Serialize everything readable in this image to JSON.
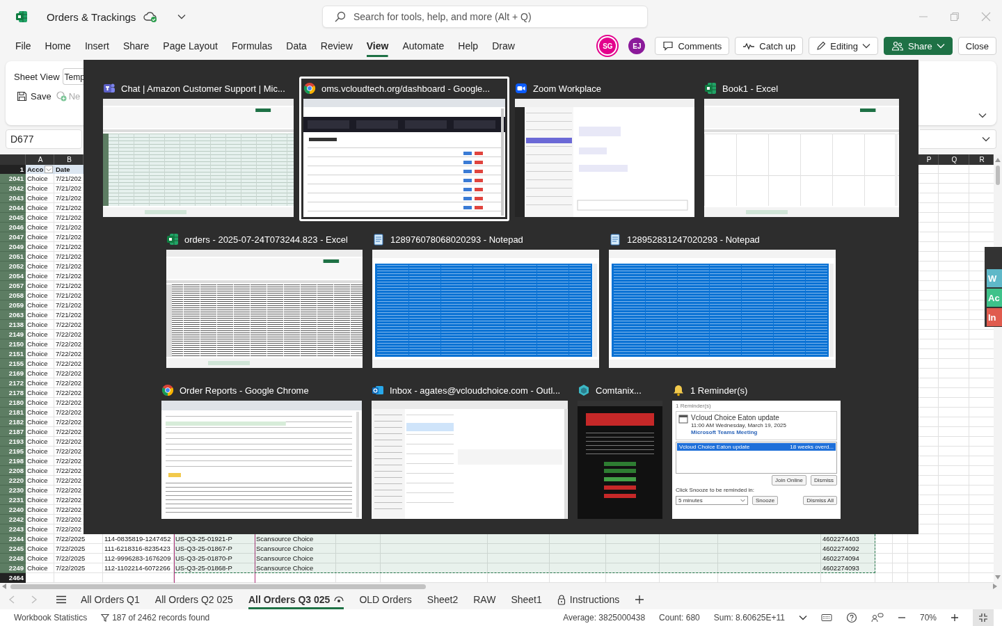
{
  "title_bar": {
    "document": "Orders & Trackings",
    "saved": true,
    "search_placeholder": "Search for tools, help, and more (Alt + Q)"
  },
  "menu": [
    {
      "label": "File",
      "selected": false
    },
    {
      "label": "Home",
      "selected": false
    },
    {
      "label": "Insert",
      "selected": false
    },
    {
      "label": "Share",
      "selected": false
    },
    {
      "label": "Page Layout",
      "selected": false
    },
    {
      "label": "Formulas",
      "selected": false
    },
    {
      "label": "Data",
      "selected": false
    },
    {
      "label": "Review",
      "selected": false
    },
    {
      "label": "View",
      "selected": true
    },
    {
      "label": "Automate",
      "selected": false
    },
    {
      "label": "Help",
      "selected": false
    },
    {
      "label": "Draw",
      "selected": false
    }
  ],
  "collaborators": [
    {
      "initials": "SG",
      "color": "#e3008c",
      "active": true
    },
    {
      "initials": "EJ",
      "color": "#8b1a9a",
      "active": false
    }
  ],
  "actions": [
    {
      "label": "Comments",
      "kind": "comments"
    },
    {
      "label": "Catch up",
      "kind": "catch-up"
    },
    {
      "label": "Editing",
      "kind": "editing"
    },
    {
      "label": "Share",
      "kind": "share"
    },
    {
      "label": "Close",
      "kind": "close"
    }
  ],
  "ribbon": {
    "sheet_view_label": "Sheet View",
    "sheet_view_value": "Temp",
    "save": "Save",
    "new": "Ne"
  },
  "name_box": "D677",
  "sheet": {
    "left_columns": [
      "A",
      "B"
    ],
    "right_columns": [
      "P",
      "Q",
      "R"
    ],
    "header_row": {
      "num": "1",
      "cells": [
        "Acco",
        "Date"
      ]
    },
    "rows": [
      {
        "num": "2041",
        "highlighted": true,
        "account": "Choice",
        "date": "7/21/202"
      },
      {
        "num": "2042",
        "highlighted": true,
        "account": "Choice",
        "date": "7/21/202"
      },
      {
        "num": "2043",
        "highlighted": true,
        "account": "Choice",
        "date": "7/21/202"
      },
      {
        "num": "2044",
        "highlighted": true,
        "account": "Choice",
        "date": "7/21/202"
      },
      {
        "num": "2045",
        "highlighted": true,
        "account": "Choice",
        "date": "7/21/202"
      },
      {
        "num": "2046",
        "highlighted": true,
        "account": "Choice",
        "date": "7/21/202"
      },
      {
        "num": "2047",
        "highlighted": true,
        "account": "Choice",
        "date": "7/21/202"
      },
      {
        "num": "2049",
        "highlighted": true,
        "account": "Choice",
        "date": "7/21/202"
      },
      {
        "num": "2051",
        "highlighted": true,
        "account": "Choice",
        "date": "7/21/202"
      },
      {
        "num": "2052",
        "highlighted": true,
        "account": "Choice",
        "date": "7/21/202"
      },
      {
        "num": "2054",
        "highlighted": true,
        "account": "Choice",
        "date": "7/21/202"
      },
      {
        "num": "2057",
        "highlighted": true,
        "account": "Choice",
        "date": "7/21/202"
      },
      {
        "num": "2058",
        "highlighted": true,
        "account": "Choice",
        "date": "7/21/202"
      },
      {
        "num": "2059",
        "highlighted": true,
        "account": "Choice",
        "date": "7/21/202"
      },
      {
        "num": "2063",
        "highlighted": true,
        "account": "Choice",
        "date": "7/21/202"
      },
      {
        "num": "2138",
        "highlighted": true,
        "account": "Choice",
        "date": "7/22/202"
      },
      {
        "num": "2149",
        "highlighted": true,
        "account": "Choice",
        "date": "7/22/202"
      },
      {
        "num": "2150",
        "highlighted": true,
        "account": "Choice",
        "date": "7/22/202"
      },
      {
        "num": "2151",
        "highlighted": true,
        "account": "Choice",
        "date": "7/22/202"
      },
      {
        "num": "2155",
        "highlighted": true,
        "account": "Choice",
        "date": "7/22/202"
      },
      {
        "num": "2169",
        "highlighted": true,
        "account": "Choice",
        "date": "7/22/202"
      },
      {
        "num": "2172",
        "highlighted": true,
        "account": "Choice",
        "date": "7/22/202"
      },
      {
        "num": "2178",
        "highlighted": true,
        "account": "Choice",
        "date": "7/22/202"
      },
      {
        "num": "2180",
        "highlighted": true,
        "account": "Choice",
        "date": "7/22/202"
      },
      {
        "num": "2181",
        "highlighted": true,
        "account": "Choice",
        "date": "7/22/202"
      },
      {
        "num": "2182",
        "highlighted": true,
        "account": "Choice",
        "date": "7/22/202"
      },
      {
        "num": "2187",
        "highlighted": true,
        "account": "Choice",
        "date": "7/22/202"
      },
      {
        "num": "2193",
        "highlighted": true,
        "account": "Choice",
        "date": "7/22/202"
      },
      {
        "num": "2195",
        "highlighted": true,
        "account": "Choice",
        "date": "7/22/202"
      },
      {
        "num": "2198",
        "highlighted": true,
        "account": "Choice",
        "date": "7/22/202"
      },
      {
        "num": "2208",
        "highlighted": true,
        "account": "Choice",
        "date": "7/22/202"
      },
      {
        "num": "2220",
        "highlighted": true,
        "account": "Choice",
        "date": "7/22/202"
      },
      {
        "num": "2230",
        "highlighted": true,
        "account": "Choice",
        "date": "7/22/202"
      },
      {
        "num": "2231",
        "highlighted": true,
        "account": "Choice",
        "date": "7/22/202"
      },
      {
        "num": "2240",
        "highlighted": true,
        "account": "Choice",
        "date": "7/22/202"
      },
      {
        "num": "2242",
        "highlighted": true,
        "account": "Choice",
        "date": "7/22/202"
      },
      {
        "num": "2243",
        "highlighted": true,
        "account": "Choice",
        "date": "7/22/202"
      },
      {
        "num": "2244",
        "highlighted": true,
        "account": "Choice",
        "date": "7/22/2025",
        "order": "114-0835819-1247452",
        "po": "US-Q3-25-01921-P",
        "vendor": "Scansource Choice",
        "tracking": "4602274403"
      },
      {
        "num": "2245",
        "highlighted": true,
        "account": "Choice",
        "date": "7/22/2025",
        "order": "111-6218316-8235423",
        "po": "US-Q3-25-01867-P",
        "vendor": "Scansource Choice",
        "tracking": "4602274092"
      },
      {
        "num": "2248",
        "highlighted": true,
        "account": "Choice",
        "date": "7/22/2025",
        "order": "112-9996283-1676209",
        "po": "US-Q3-25-01870-P",
        "vendor": "Scansource Choice",
        "tracking": "4602274094"
      },
      {
        "num": "2249",
        "highlighted": true,
        "account": "Choice",
        "date": "7/22/2025",
        "order": "112-1102214-6072266",
        "po": "US-Q3-25-01868-P",
        "vendor": "Scansource Choice",
        "tracking": "4602274093"
      },
      {
        "num": "2464",
        "highlighted": false
      }
    ]
  },
  "side_panel": {
    "buttons": [
      {
        "label": "W",
        "color": "#5fb8c8"
      },
      {
        "label": "Ac",
        "color": "#3ec28a"
      },
      {
        "label": "In",
        "color": "#e05b4e"
      }
    ]
  },
  "task_switcher": {
    "rows": [
      {
        "windows": [
          {
            "title": "Chat | Amazon Customer Support | Mic...",
            "selected": false
          },
          {
            "title": "oms.vcloudtech.org/dashboard - Google...",
            "selected": true
          },
          {
            "title": "Zoom Workplace",
            "selected": false
          },
          {
            "title": "Book1 - Excel",
            "selected": false
          }
        ]
      },
      {
        "windows": [
          {
            "title": "orders - 2025-07-24T073244.823 - Excel",
            "selected": false
          },
          {
            "title": "128976078068020293 - Notepad",
            "selected": false
          },
          {
            "title": "128952831247020293 - Notepad",
            "selected": false
          }
        ]
      },
      {
        "windows": [
          {
            "title": "Order Reports - Google Chrome",
            "selected": false
          },
          {
            "title": "Inbox - agates@vcloudchoice.com - Outl...",
            "selected": false
          },
          {
            "title": "Comtanix...",
            "selected": false
          },
          {
            "title": "1 Reminder(s)",
            "selected": false,
            "reminder": {
              "window_title": "1 Reminder(s)",
              "subject": "Vcloud Choice Eaton update",
              "when": "11:00 AM Wednesday, March 19, 2025",
              "location": "Microsoft Teams Meeting",
              "items": [
                {
                  "subject": "Vcloud Choice Eaton update",
                  "due": "18 weeks overd...",
                  "selected": true
                }
              ],
              "buttons": [
                "Join Online",
                "Dismiss"
              ],
              "snooze_prompt": "Click Snooze to be reminded in:",
              "snooze_value": "5 minutes",
              "snooze_button": "Snooze",
              "dismiss_all": "Dismiss All"
            }
          }
        ]
      }
    ]
  },
  "sheet_tabs": [
    {
      "label": "All Orders Q1",
      "selected": false,
      "locked": false
    },
    {
      "label": "All Orders Q2 025",
      "selected": false,
      "locked": false
    },
    {
      "label": "All Orders Q3 025",
      "selected": true,
      "locked": false
    },
    {
      "label": "OLD Orders",
      "selected": false,
      "locked": false
    },
    {
      "label": "Sheet2",
      "selected": false,
      "locked": false
    },
    {
      "label": "RAW",
      "selected": false,
      "locked": false
    },
    {
      "label": "Sheet1",
      "selected": false,
      "locked": false
    },
    {
      "label": "Instructions",
      "selected": false,
      "locked": true
    }
  ],
  "status_bar": {
    "workbook_statistics": "Workbook Statistics",
    "filter_status": "187 of 2462 records found",
    "stats": [
      "Average: 3825000438",
      "Count: 680",
      "Sum: 8.60625E+11"
    ],
    "zoom": "70%"
  }
}
